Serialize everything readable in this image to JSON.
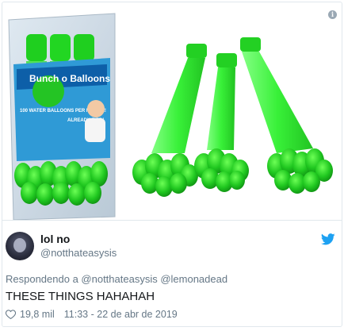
{
  "product_box": {
    "brand": "Bunch o Balloons",
    "tagline": "100 WATER BALLOONS PER MINUTE!",
    "badge": "ALREADY TIED!"
  },
  "tweet": {
    "display_name": "lol no",
    "handle": "@notthateasysis",
    "reply_context": "Respondendo a @notthateasysis @lemonadead",
    "text": "THESE THINGS HAHAHAH",
    "likes": "19,8 mil",
    "timestamp": "11:33 - 22 de abr de 2019"
  },
  "colors": {
    "brand_blue": "#1da1f2",
    "balloon_green": "#22cc22",
    "text_primary": "#14171a",
    "text_secondary": "#657786"
  },
  "icons": {
    "info": "info-icon",
    "twitter": "twitter-bird-icon",
    "like": "heart-icon"
  }
}
